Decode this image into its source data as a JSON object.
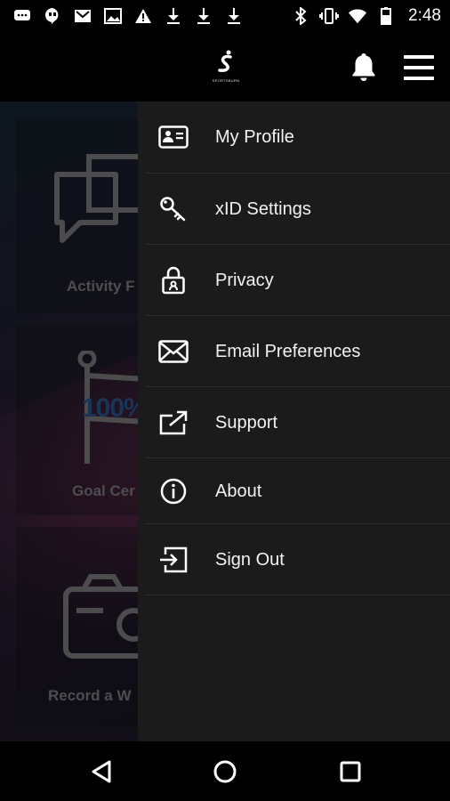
{
  "status_bar": {
    "time": "2:48",
    "left_icons": [
      "message-icon",
      "hangouts-icon",
      "gmail-icon",
      "image-icon",
      "warning-icon",
      "download-icon",
      "download-icon",
      "download-icon"
    ],
    "right_icons": [
      "bluetooth-icon",
      "vibrate-icon",
      "wifi-icon",
      "battery-icon"
    ]
  },
  "header": {
    "logo_text": "SPORTSBURN",
    "bell_icon": "bell-icon",
    "menu_icon": "hamburger-menu-icon"
  },
  "background_tiles": [
    {
      "label": "Activity F",
      "icon": "chat-bubbles-icon"
    },
    {
      "label": "Goal Cer",
      "icon": "flag-icon",
      "badge_text": "100%"
    },
    {
      "label": "Record a W",
      "icon": "camera-icon"
    }
  ],
  "drawer": {
    "items": [
      {
        "label": "My Profile",
        "icon": "id-card-icon"
      },
      {
        "label": "xID Settings",
        "icon": "key-icon"
      },
      {
        "label": "Privacy",
        "icon": "lock-icon"
      },
      {
        "label": "Email Preferences",
        "icon": "envelope-icon"
      },
      {
        "label": "Support",
        "icon": "external-link-icon"
      },
      {
        "label": "About",
        "icon": "info-icon"
      },
      {
        "label": "Sign Out",
        "icon": "sign-out-icon"
      }
    ]
  },
  "nav_bar": {
    "back_icon": "back-triangle-icon",
    "home_icon": "home-circle-icon",
    "recents_icon": "recents-square-icon"
  },
  "colors": {
    "drawer_bg": "#1b1b1b",
    "divider": "#2e2e2e",
    "text": "#f2f2f2",
    "bar_bg": "#000000"
  }
}
